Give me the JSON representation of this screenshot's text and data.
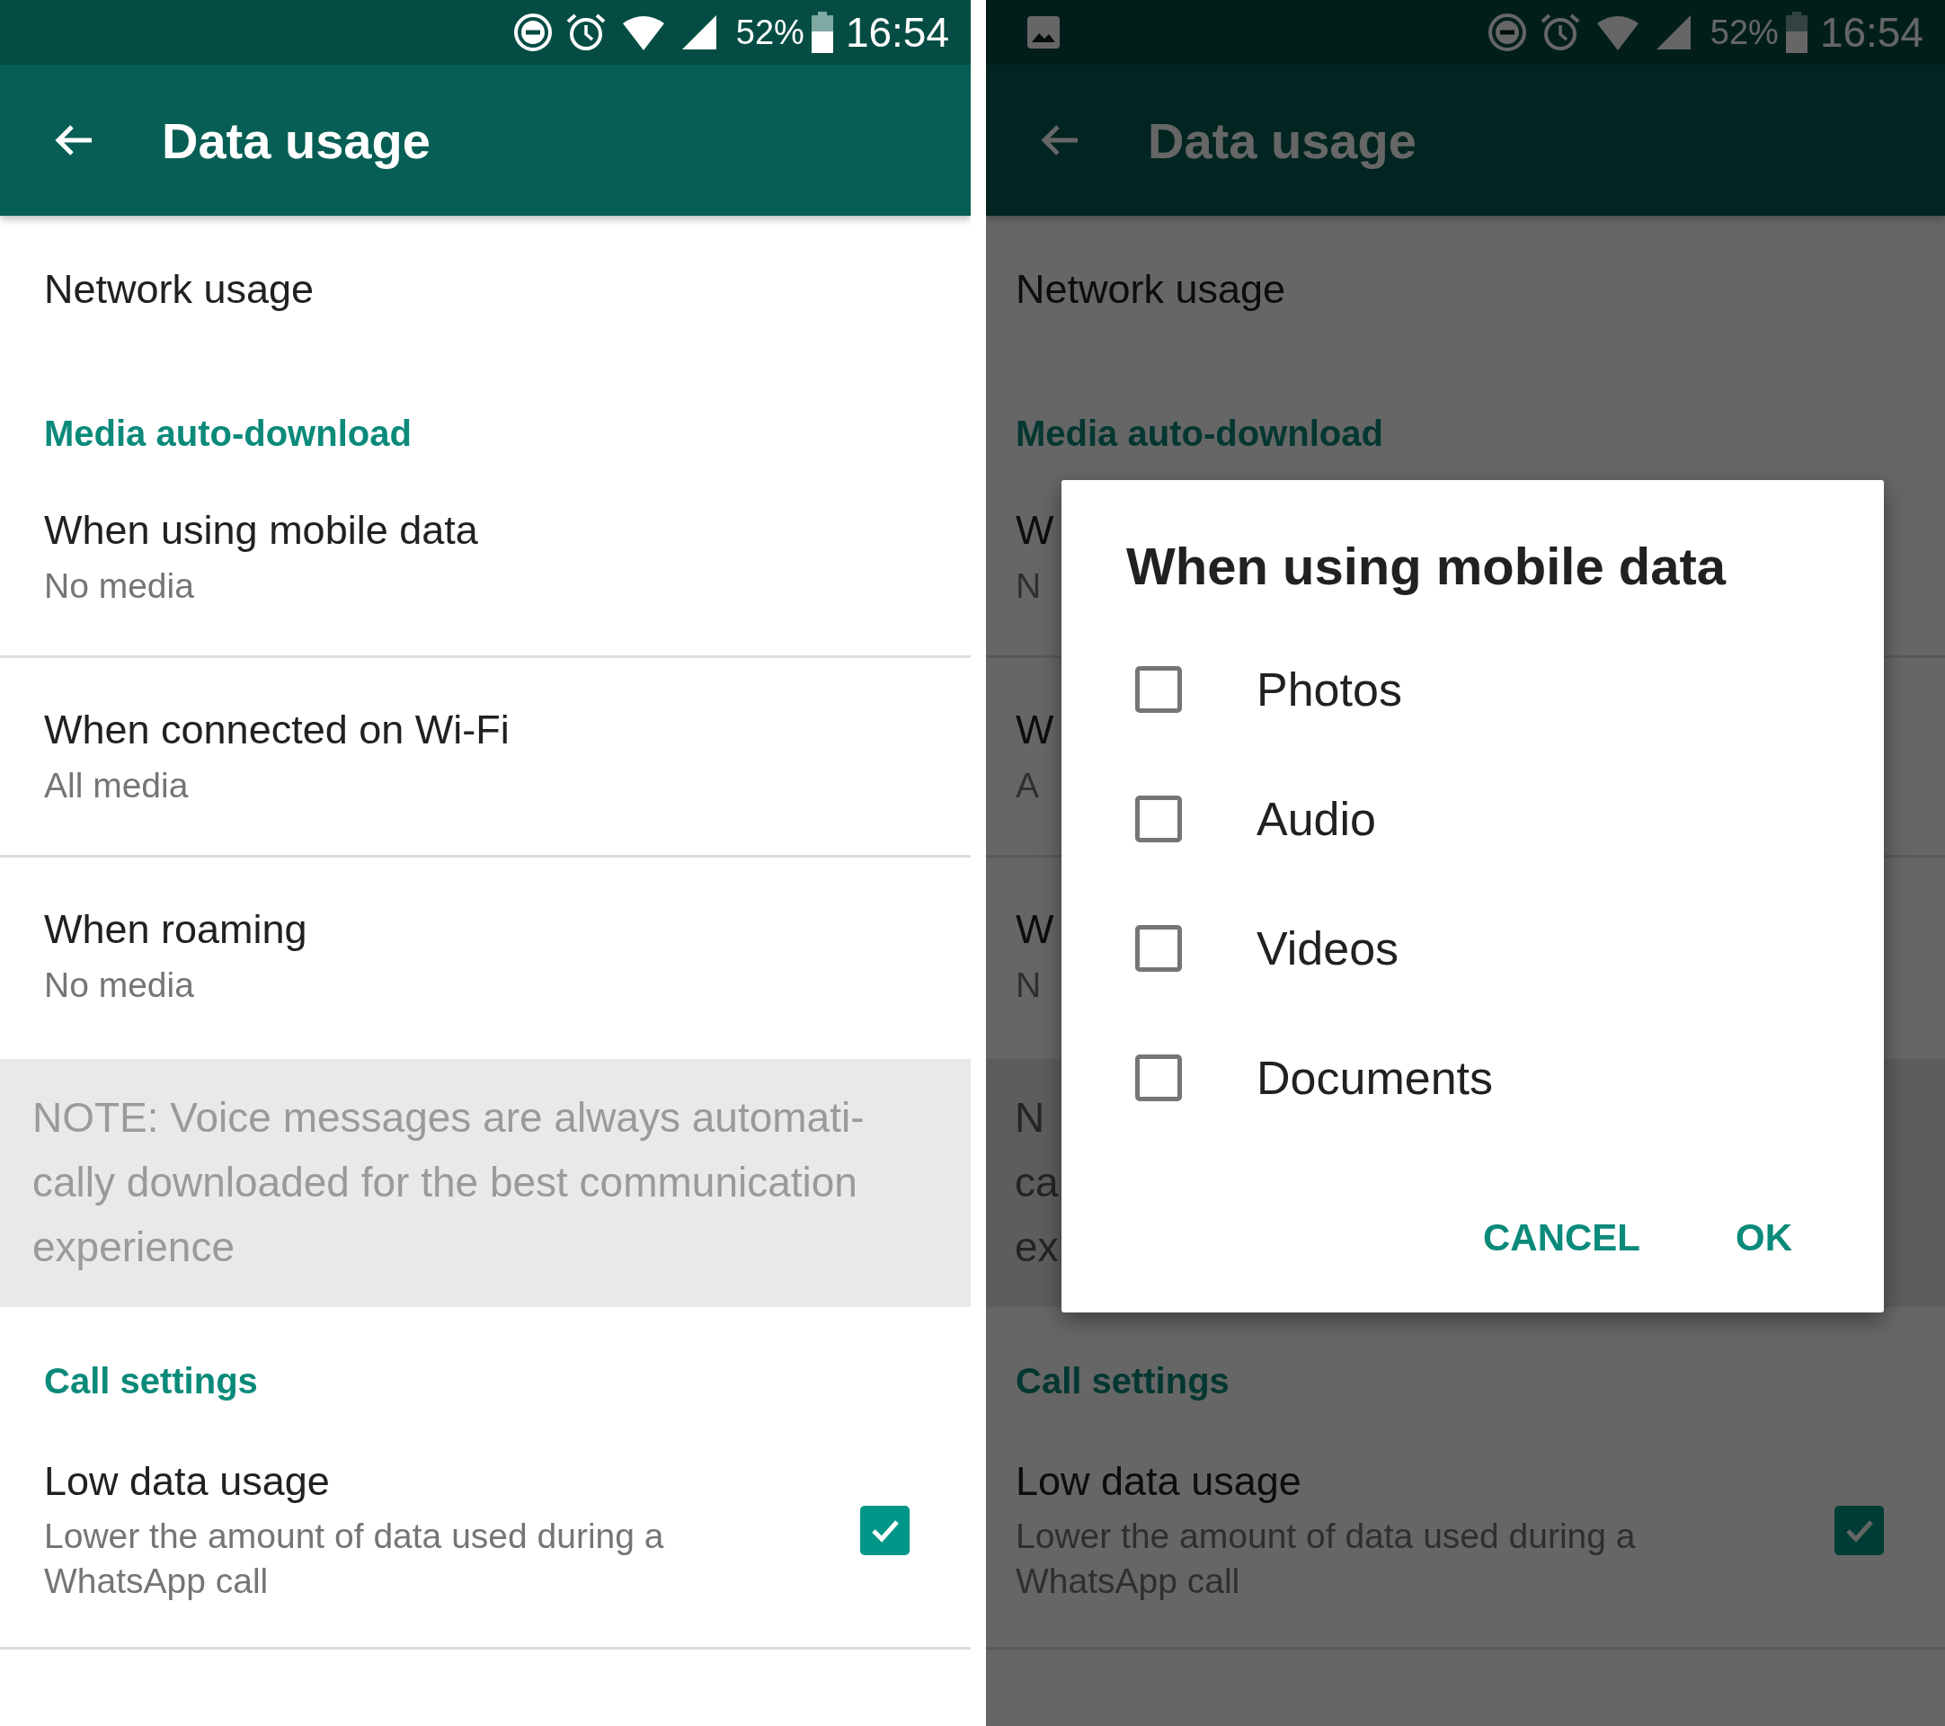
{
  "screens": [
    {
      "dimmed": false,
      "status_bar": {
        "battery": "52%",
        "time": "16:54"
      },
      "toolbar": {
        "title": "Data usage"
      },
      "items": [
        {
          "kind": "row",
          "title": "Network usage",
          "divider": false
        },
        {
          "kind": "header",
          "title": "Media auto-download"
        },
        {
          "kind": "row",
          "title": "When using mobile data",
          "subtitle": "No media",
          "divider": true
        },
        {
          "kind": "row",
          "title": "When connected on Wi-Fi",
          "subtitle": "All media",
          "divider": true
        },
        {
          "kind": "row",
          "title": "When roaming",
          "subtitle": "No media",
          "divider": false
        },
        {
          "kind": "note",
          "lines": [
            "NOTE: Voice messages are always automati-",
            "cally downloaded for the best communication",
            "experience"
          ]
        },
        {
          "kind": "header",
          "title": "Call settings"
        },
        {
          "kind": "check",
          "title": "Low data usage",
          "lines": [
            "Lower the amount of data used during a",
            "WhatsApp call"
          ],
          "checked": true
        }
      ]
    },
    {
      "dimmed": true,
      "status_bar": {
        "notifications": [
          {
            "kind": "image"
          }
        ],
        "battery": "52%",
        "time": "16:54"
      },
      "toolbar": {
        "title": "Data usage"
      },
      "items": [
        {
          "kind": "row",
          "title": "Network usage",
          "divider": false
        },
        {
          "kind": "header",
          "title": "Media auto-download"
        },
        {
          "kind": "row",
          "title": "W",
          "subtitle": "N",
          "divider": true
        },
        {
          "kind": "row",
          "title": "W",
          "subtitle": "A",
          "divider": true
        },
        {
          "kind": "row",
          "title": "W",
          "subtitle": "N",
          "divider": false
        },
        {
          "kind": "note",
          "lines": [
            "N",
            "ca",
            "ex"
          ]
        },
        {
          "kind": "header",
          "title": "Call settings"
        },
        {
          "kind": "check",
          "title": "Low data usage",
          "lines": [
            "Lower the amount of data used during a",
            "WhatsApp call"
          ],
          "checked": true
        }
      ],
      "dialog": {
        "title": "When using mobile data",
        "options": [
          {
            "label": "Photos",
            "checked": false
          },
          {
            "label": "Audio",
            "checked": false
          },
          {
            "label": "Videos",
            "checked": false
          },
          {
            "label": "Documents",
            "checked": false
          }
        ],
        "buttons": [
          {
            "label": "CANCEL"
          },
          {
            "label": "OK"
          }
        ]
      }
    }
  ]
}
